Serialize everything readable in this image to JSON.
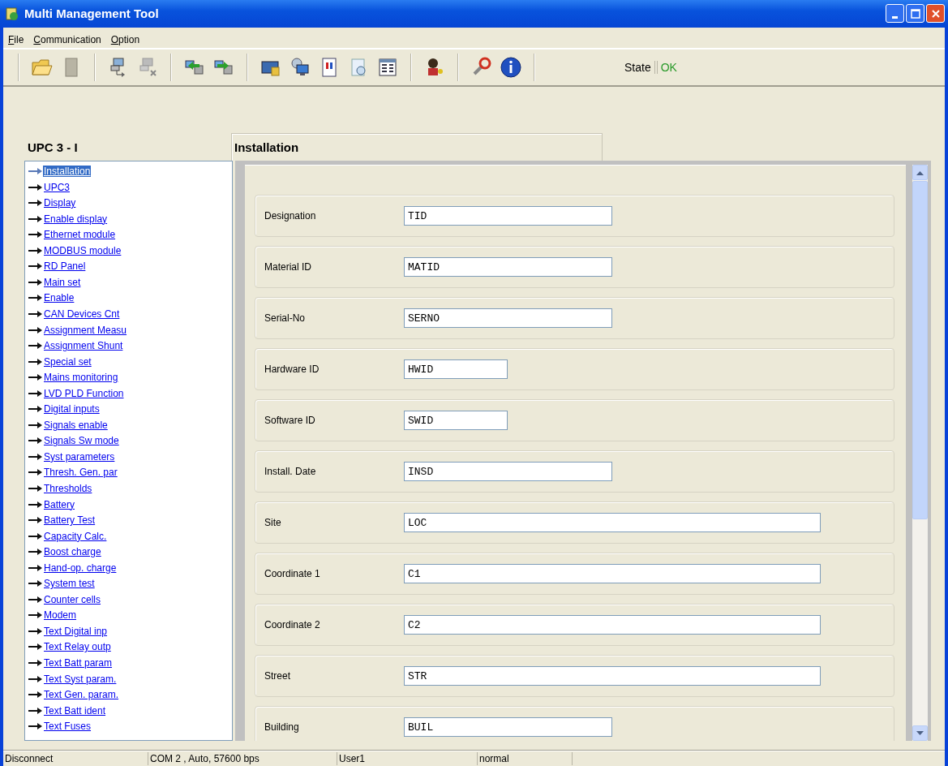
{
  "window": {
    "title": "Multi Management Tool"
  },
  "menu": [
    {
      "label": "File"
    },
    {
      "label": "Communication"
    },
    {
      "label": "Option"
    }
  ],
  "toolbar": {
    "state_label": "State",
    "state_value": "OK"
  },
  "device": {
    "title": "UPC 3 - I"
  },
  "tree": {
    "items": [
      {
        "label": "Installation",
        "selected": true
      },
      {
        "label": "UPC3",
        "selected": false
      },
      {
        "label": "Display",
        "selected": false
      },
      {
        "label": "Enable display",
        "selected": false
      },
      {
        "label": "Ethernet module",
        "selected": false
      },
      {
        "label": "MODBUS module",
        "selected": false
      },
      {
        "label": "RD Panel",
        "selected": false
      },
      {
        "label": "Main set",
        "selected": false
      },
      {
        "label": "Enable",
        "selected": false
      },
      {
        "label": "CAN Devices Cnt",
        "selected": false
      },
      {
        "label": "Assignment Measu",
        "selected": false
      },
      {
        "label": "Assignment Shunt",
        "selected": false
      },
      {
        "label": "Special set",
        "selected": false
      },
      {
        "label": "Mains monitoring",
        "selected": false
      },
      {
        "label": "LVD PLD Function",
        "selected": false
      },
      {
        "label": "Digital inputs",
        "selected": false
      },
      {
        "label": "Signals enable",
        "selected": false
      },
      {
        "label": "Signals Sw mode",
        "selected": false
      },
      {
        "label": "Syst parameters",
        "selected": false
      },
      {
        "label": "Thresh. Gen. par",
        "selected": false
      },
      {
        "label": "Thresholds",
        "selected": false
      },
      {
        "label": "Battery",
        "selected": false
      },
      {
        "label": "Battery Test",
        "selected": false
      },
      {
        "label": "Capacity Calc.",
        "selected": false
      },
      {
        "label": "Boost charge",
        "selected": false
      },
      {
        "label": "Hand-op. charge",
        "selected": false
      },
      {
        "label": "System test",
        "selected": false
      },
      {
        "label": "Counter cells",
        "selected": false
      },
      {
        "label": "Modem",
        "selected": false
      },
      {
        "label": "Text Digital inp",
        "selected": false
      },
      {
        "label": "Text Relay outp",
        "selected": false
      },
      {
        "label": "Text Batt param",
        "selected": false
      },
      {
        "label": "Text Syst param.",
        "selected": false
      },
      {
        "label": "Text Gen. param.",
        "selected": false
      },
      {
        "label": "Text Batt ident",
        "selected": false
      },
      {
        "label": "Text Fuses",
        "selected": false
      }
    ]
  },
  "panel": {
    "title": "Installation",
    "fields": [
      {
        "label": "Designation",
        "value": "TID",
        "kind": "medium"
      },
      {
        "label": "Material ID",
        "value": "MATID",
        "kind": "medium"
      },
      {
        "label": "Serial-No",
        "value": "SERNO",
        "kind": "medium"
      },
      {
        "label": "Hardware ID",
        "value": "HWID",
        "kind": "short"
      },
      {
        "label": "Software ID",
        "value": "SWID",
        "kind": "short"
      },
      {
        "label": "Install. Date",
        "value": "INSD",
        "kind": "medium"
      },
      {
        "label": "Site",
        "value": "LOC",
        "kind": "long"
      },
      {
        "label": "Coordinate 1",
        "value": "C1",
        "kind": "long"
      },
      {
        "label": "Coordinate 2",
        "value": "C2",
        "kind": "long"
      },
      {
        "label": "Street",
        "value": "STR",
        "kind": "long"
      },
      {
        "label": "Building",
        "value": "BUIL",
        "kind": "medium"
      }
    ]
  },
  "status_bar": [
    "Disconnect",
    "COM 2 , Auto, 57600 bps",
    "User1",
    "normal"
  ]
}
